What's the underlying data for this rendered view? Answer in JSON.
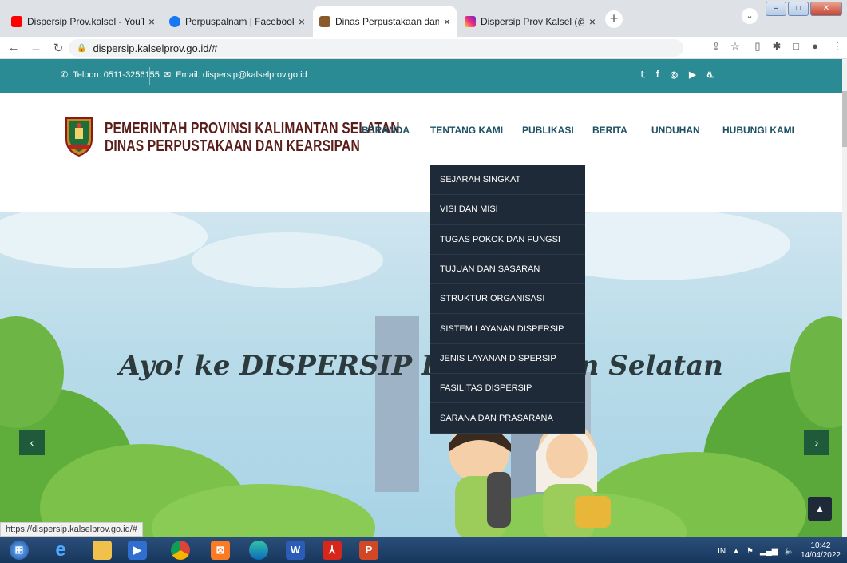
{
  "browser": {
    "tabs": [
      {
        "title": "Dispersip Prov.kalsel - YouTube",
        "favicon": "youtube-icon",
        "color": "#ff0000"
      },
      {
        "title": "Perpuspalnam | Facebook",
        "favicon": "facebook-icon",
        "color": "#1877f2"
      },
      {
        "title": "Dinas Perpustakaan dan Kearsipa",
        "favicon": "government-seal-icon",
        "color": "#8a5a2b",
        "active": true
      },
      {
        "title": "Dispersip Prov Kalsel (@perpusp",
        "favicon": "instagram-icon",
        "color": "#d6249f"
      }
    ],
    "url": "dispersip.kalselprov.go.id/#",
    "status_url": "https://dispersip.kalselprov.go.id/#"
  },
  "topbar": {
    "phone": "Telpon: 0511-3256155",
    "email": "Email: dispersip@kalselprov.go.id",
    "social": [
      "twitter-icon",
      "facebook-icon",
      "instagram-icon",
      "youtube-icon",
      "rss-icon"
    ]
  },
  "brand": {
    "line1": "PEMERINTAH PROVINSI KALIMANTAN SELATAN",
    "line2": "DINAS PERPUSTAKAAN DAN KEARSIPAN"
  },
  "nav": {
    "items": [
      "BERANDA",
      "TENTANG KAMI",
      "PUBLIKASI",
      "BERITA",
      "UNDUHAN",
      "HUBUNGI KAMI"
    ]
  },
  "dropdown": {
    "items": [
      "SEJARAH SINGKAT",
      "VISI DAN MISI",
      "TUGAS POKOK DAN FUNGSI",
      "TUJUAN DAN SASARAN",
      "STRUKTUR ORGANISASI",
      "SISTEM LAYANAN DISPERSIP",
      "JENIS LAYANAN DISPERSIP",
      "FASILITAS DISPERSIP",
      "SARANA DAN PRASARANA"
    ]
  },
  "hero": {
    "text": "Ayo! ke DISPERSIP Kalimantan Selatan",
    "prev": "‹",
    "next": "›"
  },
  "taskbar": {
    "lang": "IN",
    "time": "10:42",
    "date": "14/04/2022"
  },
  "colors": {
    "topbar": "#2a8b95",
    "nav_text": "#1d5163",
    "dropdown_bg": "#1e2a38",
    "brand_text": "#5a1e1a"
  }
}
